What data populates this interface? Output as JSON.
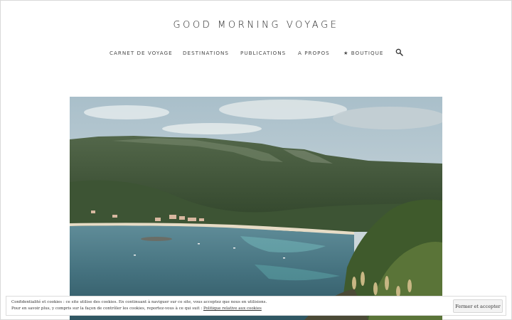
{
  "site": {
    "title": "GOOD MORNING VOYAGE"
  },
  "nav": {
    "items": [
      {
        "label": "CARNET DE VOYAGE"
      },
      {
        "label": "DESTINATIONS"
      },
      {
        "label": "PUBLICATIONS"
      },
      {
        "label": "A PROPOS"
      },
      {
        "label": "★ BOUTIQUE"
      }
    ],
    "search_icon": "search-icon"
  },
  "hero": {
    "image": "coastal-bay-photo"
  },
  "cookie_bar": {
    "line1": "Confidentialité et cookies : ce site utilise des cookies. En continuant à naviguer sur ce site, vous acceptez que nous en utilisions.",
    "line2_prefix": "Pour en savoir plus, y compris sur la façon de contrôler les cookies, reportez-vous à ce qui suit : ",
    "policy_link": "Politique relative aux cookies",
    "accept_label": "Fermer et accepter"
  }
}
